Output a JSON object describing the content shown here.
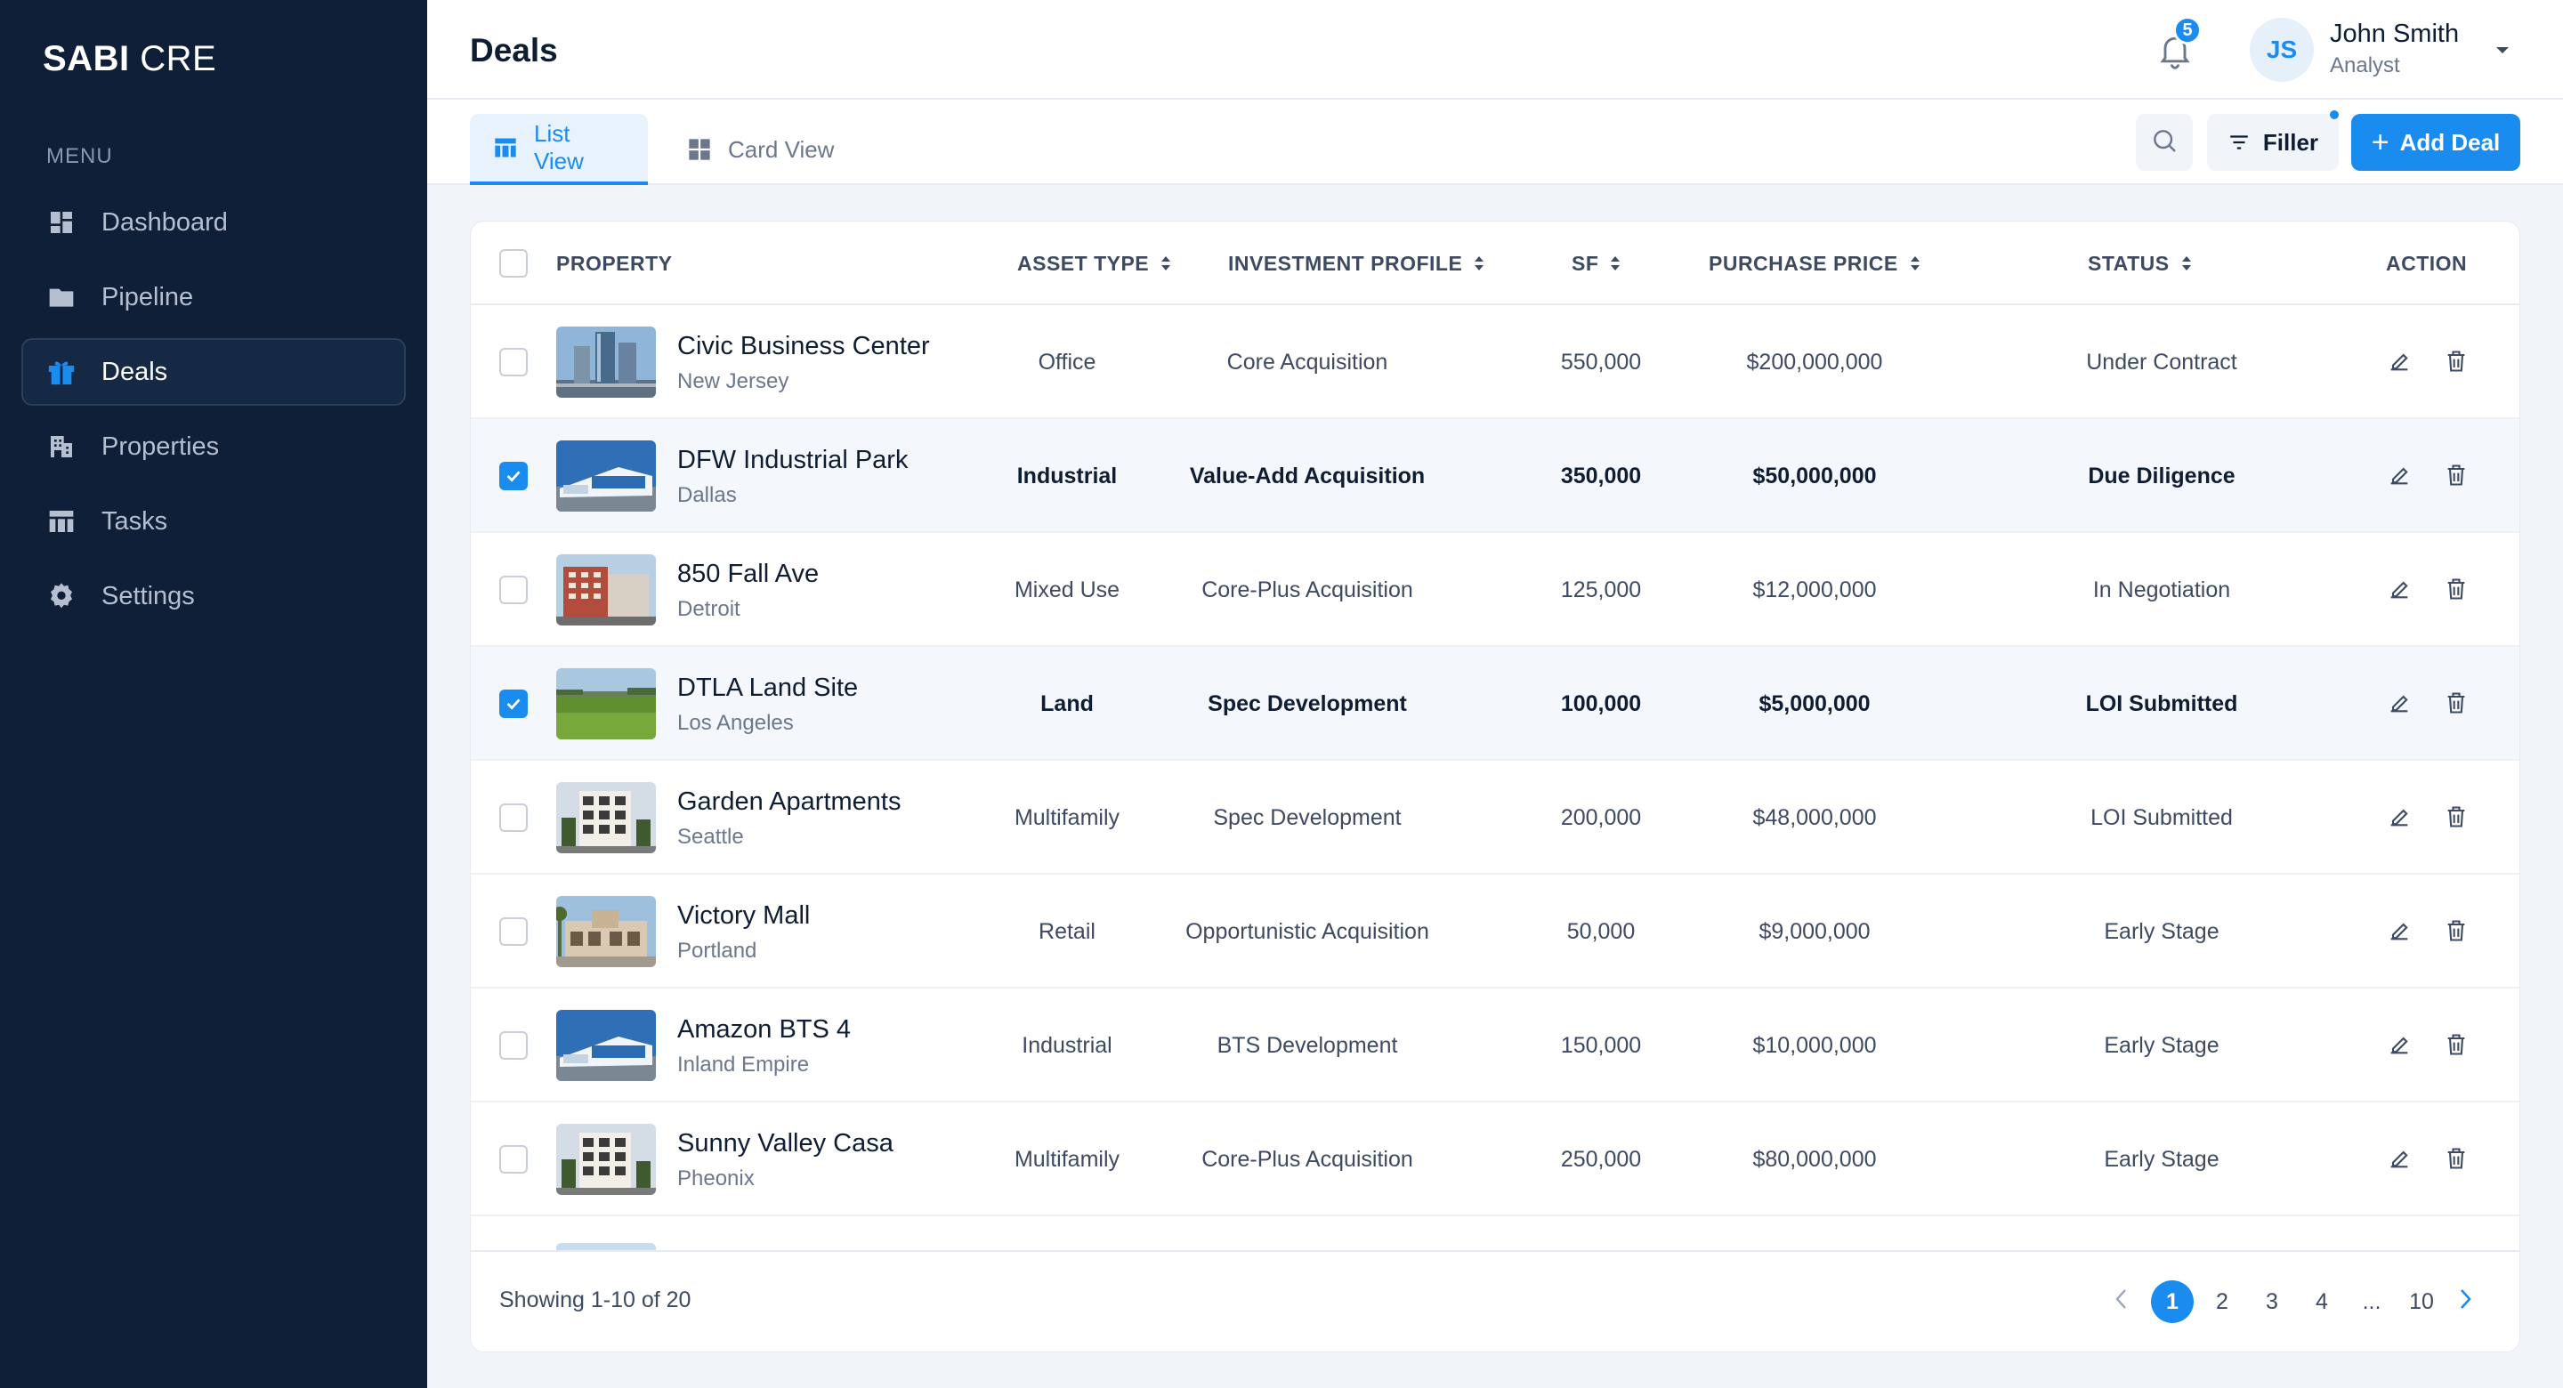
{
  "app": {
    "logo_bold": "SABI",
    "logo_rest": "CRE"
  },
  "sidebar": {
    "menu_label": "MENU",
    "items": [
      {
        "label": "Dashboard",
        "icon": "dashboard-icon"
      },
      {
        "label": "Pipeline",
        "icon": "folder-icon"
      },
      {
        "label": "Deals",
        "icon": "gift-icon",
        "active": true
      },
      {
        "label": "Properties",
        "icon": "building-icon"
      },
      {
        "label": "Tasks",
        "icon": "table-icon"
      },
      {
        "label": "Settings",
        "icon": "gear-icon"
      }
    ]
  },
  "header": {
    "title": "Deals",
    "notification_count": "5",
    "user": {
      "initials": "JS",
      "name": "John Smith",
      "role": "Analyst"
    }
  },
  "toolbar": {
    "tabs": [
      {
        "label": "List View",
        "icon": "list-view-icon",
        "active": true
      },
      {
        "label": "Card View",
        "icon": "grid-view-icon",
        "active": false
      }
    ],
    "filter_label": "Filler",
    "add_label": "Add Deal"
  },
  "table": {
    "columns": {
      "property": "PROPERTY",
      "asset_type": "ASSET TYPE",
      "investment_profile": "INVESTMENT PROFILE",
      "sf": "SF",
      "purchase_price": "PURCHASE PRICE",
      "status": "STATUS",
      "action": "ACTION"
    },
    "rows": [
      {
        "name": "Civic Business Center",
        "city": "New Jersey",
        "asset_type": "Office",
        "profile": "Core Acquisition",
        "sf": "550,000",
        "price": "$200,000,000",
        "status": "Under Contract",
        "selected": false,
        "thumb": "tower"
      },
      {
        "name": "DFW Industrial Park",
        "city": "Dallas",
        "asset_type": "Industrial",
        "profile": "Value-Add Acquisition",
        "sf": "350,000",
        "price": "$50,000,000",
        "status": "Due Diligence",
        "selected": true,
        "thumb": "industrial"
      },
      {
        "name": "850 Fall Ave",
        "city": "Detroit",
        "asset_type": "Mixed Use",
        "profile": "Core-Plus Acquisition",
        "sf": "125,000",
        "price": "$12,000,000",
        "status": "In Negotiation",
        "selected": false,
        "thumb": "mixed"
      },
      {
        "name": "DTLA Land Site",
        "city": "Los Angeles",
        "asset_type": "Land",
        "profile": "Spec Development",
        "sf": "100,000",
        "price": "$5,000,000",
        "status": "LOI Submitted",
        "selected": true,
        "thumb": "land"
      },
      {
        "name": "Garden Apartments",
        "city": "Seattle",
        "asset_type": "Multifamily",
        "profile": "Spec Development",
        "sf": "200,000",
        "price": "$48,000,000",
        "status": "LOI Submitted",
        "selected": false,
        "thumb": "apartment"
      },
      {
        "name": "Victory Mall",
        "city": "Portland",
        "asset_type": "Retail",
        "profile": "Opportunistic Acquisition",
        "sf": "50,000",
        "price": "$9,000,000",
        "status": "Early Stage",
        "selected": false,
        "thumb": "mall"
      },
      {
        "name": "Amazon BTS 4",
        "city": "Inland Empire",
        "asset_type": "Industrial",
        "profile": "BTS Development",
        "sf": "150,000",
        "price": "$10,000,000",
        "status": "Early Stage",
        "selected": false,
        "thumb": "industrial"
      },
      {
        "name": "Sunny Valley Casa",
        "city": "Pheonix",
        "asset_type": "Multifamily",
        "profile": "Core-Plus Acquisition",
        "sf": "250,000",
        "price": "$80,000,000",
        "status": "Early Stage",
        "selected": false,
        "thumb": "apartment"
      }
    ]
  },
  "pagination": {
    "showing": "Showing 1-10 of 20",
    "pages": [
      "1",
      "2",
      "3",
      "4",
      "...",
      "10"
    ],
    "current": "1"
  },
  "colors": {
    "sidebar_bg": "#0f1f38",
    "accent": "#1a8cf0",
    "page_bg": "#f1f4f8"
  }
}
